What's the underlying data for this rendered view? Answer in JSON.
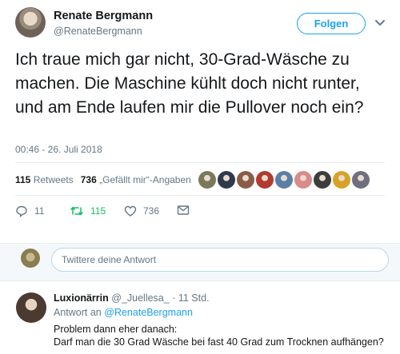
{
  "tweet": {
    "author_name": "Renate Bergmann",
    "author_handle": "@RenateBergmann",
    "follow_label": "Folgen",
    "text": "Ich traue mich gar nicht, 30-Grad-Wäsche zu machen. Die Maschine kühlt doch nicht runter, und am Ende laufen mir die Pullover noch ein?",
    "timestamp": "00:46 - 26. Juli 2018"
  },
  "stats": {
    "retweets_count": "115",
    "retweets_label": "Retweets",
    "likes_count": "736",
    "likes_label": "„Gefällt mir“-Angaben"
  },
  "likers": [
    {
      "icon": "avatar-1",
      "color": "#7a7a5a"
    },
    {
      "icon": "avatar-2",
      "color": "#2f3b4a"
    },
    {
      "icon": "avatar-3",
      "color": "#8c5a48"
    },
    {
      "icon": "avatar-4",
      "color": "#b23a2e"
    },
    {
      "icon": "avatar-5",
      "color": "#5b7fa6"
    },
    {
      "icon": "avatar-6",
      "color": "#d98a8a"
    },
    {
      "icon": "avatar-7",
      "color": "#3d3d3d"
    },
    {
      "icon": "avatar-8",
      "color": "#d9a227"
    },
    {
      "icon": "avatar-9",
      "color": "#6f6f80"
    }
  ],
  "actions": {
    "reply_count": "11",
    "retweet_count": "115",
    "like_count": "736"
  },
  "reply_box": {
    "placeholder": "Twittere deine Antwort"
  },
  "reply": {
    "author_name": "Luxionärrin",
    "author_handle": "@_Juellesa_",
    "time": "· 11 Std.",
    "reply_to_prefix": "Antwort an",
    "reply_to_handle": "@RenateBergmann",
    "line1": "Problem dann eher danach:",
    "line2": "Darf man die 30 Grad Wäsche bei fast 40 Grad zum Trocknen aufhängen?"
  },
  "colors": {
    "accent": "#1da1f2",
    "retweet_green": "#17bf63",
    "muted": "#657786"
  }
}
